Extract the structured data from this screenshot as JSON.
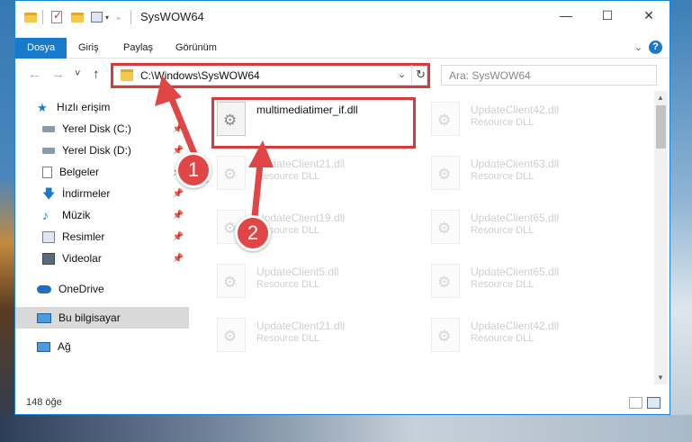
{
  "window": {
    "title": "SysWOW64",
    "minimize_glyph": "—",
    "maximize_glyph": "☐",
    "close_glyph": "✕"
  },
  "ribbon": {
    "tabs": [
      "Dosya",
      "Giriş",
      "Paylaş",
      "Görünüm"
    ],
    "expand_glyph": "⌄",
    "help_glyph": "?"
  },
  "nav": {
    "back_glyph": "←",
    "forward_glyph": "→",
    "recent_glyph": "˅",
    "up_glyph": "↑",
    "address": "C:\\Windows\\SysWOW64",
    "address_dropdown_glyph": "⌄",
    "refresh_glyph": "↻",
    "search_placeholder": "Ara: SysWOW64"
  },
  "sidebar": {
    "items": [
      {
        "label": "Hızlı erişim",
        "icon": "star-icon",
        "pinned": false
      },
      {
        "label": "Yerel Disk (C:)",
        "icon": "drive-icon",
        "pinned": true
      },
      {
        "label": "Yerel Disk (D:)",
        "icon": "drive-icon",
        "pinned": true
      },
      {
        "label": "Belgeler",
        "icon": "document-icon",
        "pinned": true
      },
      {
        "label": "İndirmeler",
        "icon": "download-icon",
        "pinned": true
      },
      {
        "label": "Müzik",
        "icon": "music-icon",
        "pinned": true
      },
      {
        "label": "Resimler",
        "icon": "pictures-icon",
        "pinned": true
      },
      {
        "label": "Videolar",
        "icon": "video-icon",
        "pinned": true
      },
      {
        "label": "OneDrive",
        "icon": "cloud-icon",
        "pinned": false
      },
      {
        "label": "Bu bilgisayar",
        "icon": "computer-icon",
        "pinned": false,
        "selected": true
      },
      {
        "label": "Ağ",
        "icon": "network-icon",
        "pinned": false
      }
    ],
    "pin_glyph": "📌"
  },
  "files": [
    {
      "name": "multimediatimer_if.dll",
      "type": "",
      "highlighted": true
    },
    {
      "name": "UpdateClient42.dll",
      "type": "Resource DLL"
    },
    {
      "name": "UpdateClient21.dll",
      "type": "Resource DLL"
    },
    {
      "name": "UpdateClient63.dll",
      "type": "Resource DLL"
    },
    {
      "name": "UpdateClient19.dll",
      "type": "Resource DLL"
    },
    {
      "name": "UpdateClient65.dll",
      "type": "Resource DLL"
    },
    {
      "name": "UpdateClient5.dll",
      "type": "Resource DLL"
    },
    {
      "name": "UpdateClient65.dll",
      "type": "Resource DLL"
    },
    {
      "name": "UpdateClient21.dll",
      "type": "Resource DLL"
    },
    {
      "name": "UpdateClient42.dll",
      "type": "Resource DLL"
    }
  ],
  "status": {
    "item_count": "148 öğe"
  },
  "annotations": {
    "badge_1": "1",
    "badge_2": "2",
    "color": "#e04646"
  }
}
